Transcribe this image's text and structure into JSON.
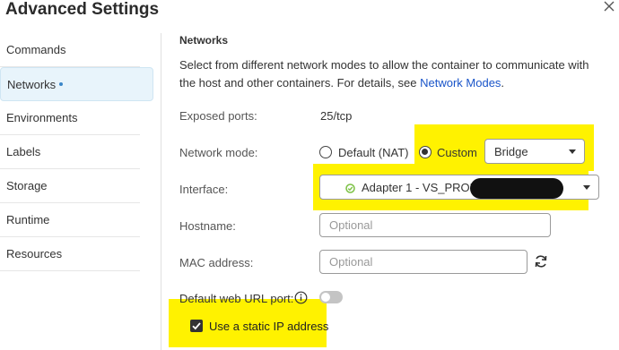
{
  "dialog": {
    "title": "Advanced Settings",
    "close_icon": "close-icon"
  },
  "sidebar": {
    "items": [
      {
        "label": "Commands"
      },
      {
        "label": "Networks",
        "active": true
      },
      {
        "label": "Environments"
      },
      {
        "label": "Labels"
      },
      {
        "label": "Storage"
      },
      {
        "label": "Runtime"
      },
      {
        "label": "Resources"
      }
    ]
  },
  "networks": {
    "section_title": "Networks",
    "description": "Select from different network modes to allow the container to communicate with the host and other containers. For details, see ",
    "description_link": "Network Modes",
    "description_end": ".",
    "exposed_ports": {
      "label": "Exposed ports:",
      "value": "25/tcp"
    },
    "network_mode": {
      "label": "Network mode:",
      "option_default": "Default (NAT)",
      "option_custom": "Custom",
      "selected": "Custom",
      "custom_value": "Bridge"
    },
    "interface": {
      "label": "Interface:",
      "value": "Adapter 1 - VS_PROD",
      "status_color": "#7bc143"
    },
    "hostname": {
      "label": "Hostname:",
      "placeholder": "Optional"
    },
    "mac_address": {
      "label": "MAC address:",
      "placeholder": "Optional",
      "refresh_icon": "refresh-icon"
    },
    "default_web_url_port": {
      "label": "Default web URL port:",
      "info_icon": "info-icon",
      "enabled": false
    },
    "static_ip": {
      "label": "Use a static IP address",
      "checked": true
    }
  },
  "colors": {
    "highlight": "#fff200",
    "link": "#1a55c9",
    "active_bg": "#e8f4fb"
  }
}
